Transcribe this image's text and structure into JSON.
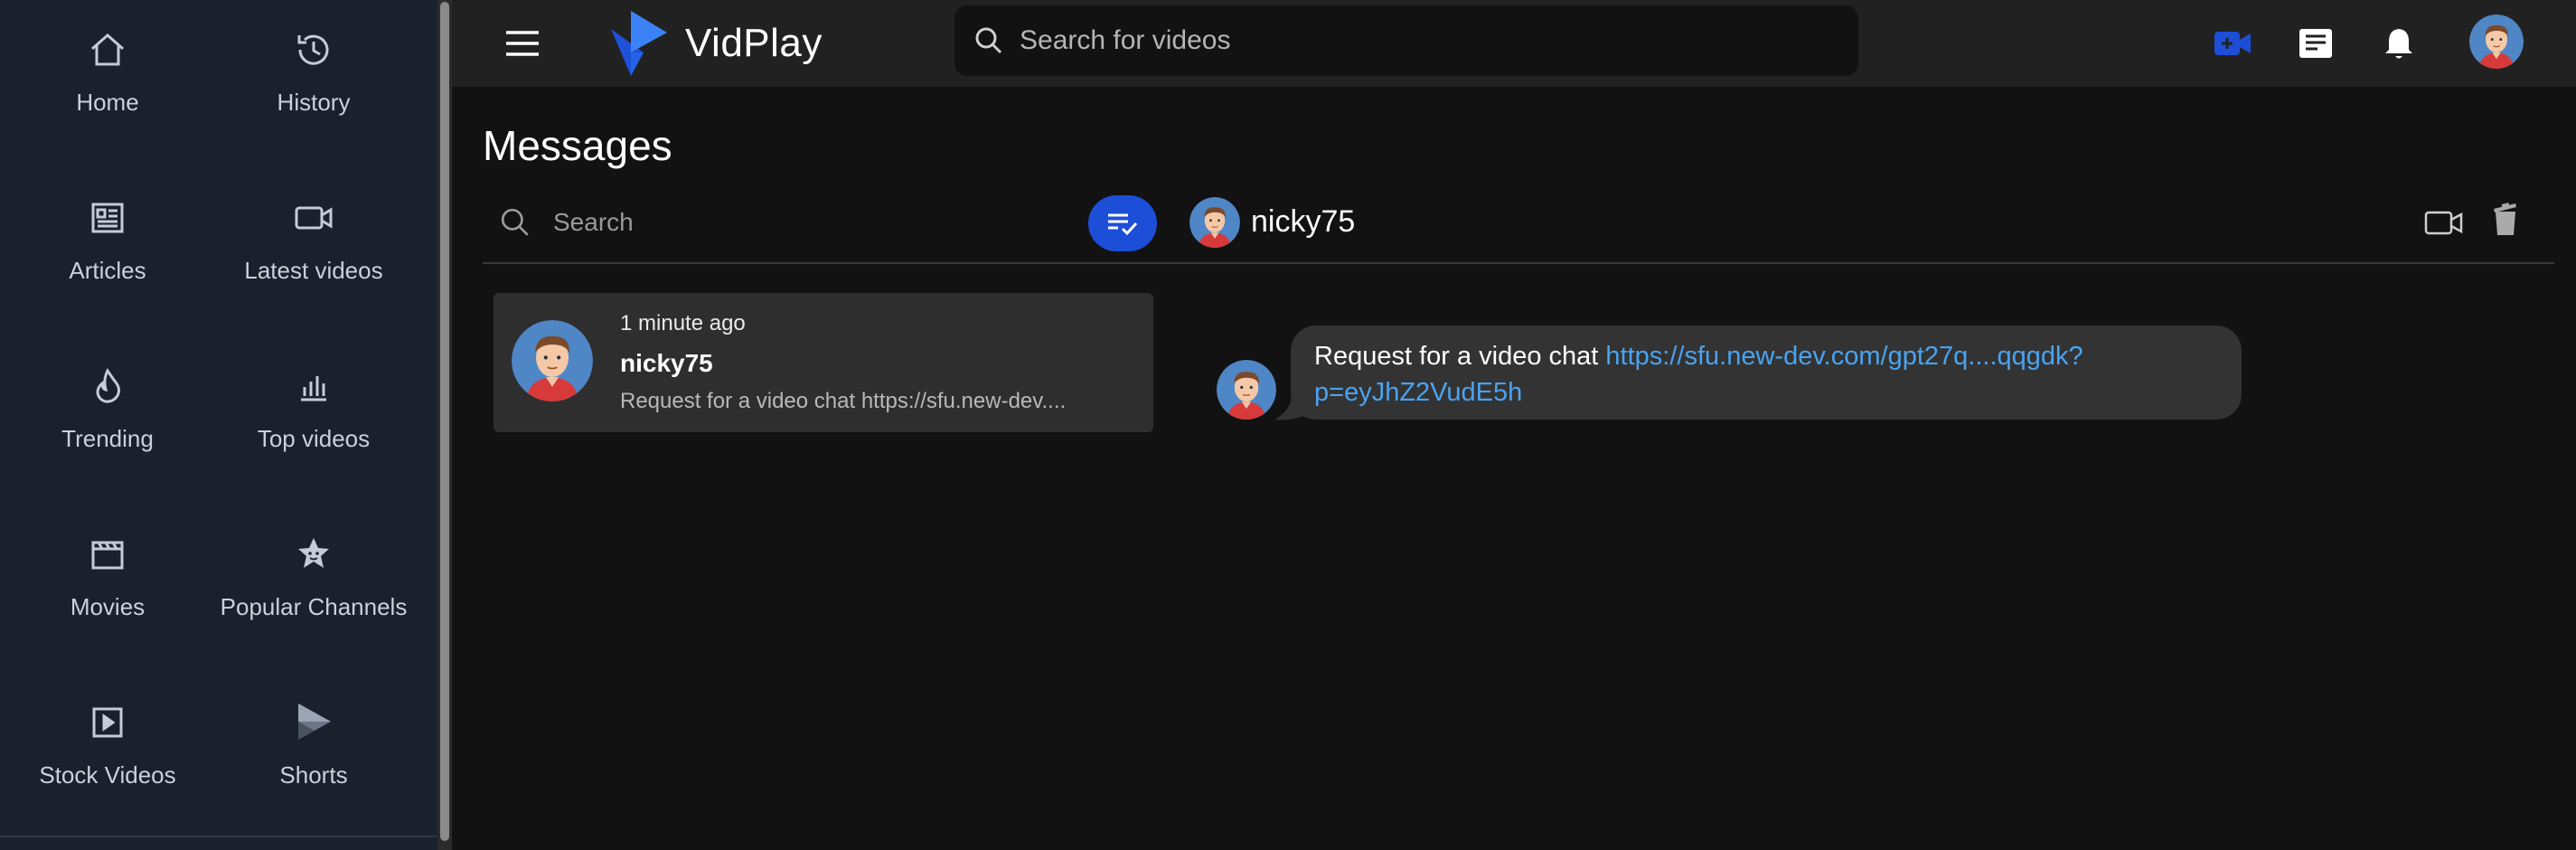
{
  "sidebar": {
    "items": [
      {
        "label": "Home",
        "icon": "home-icon"
      },
      {
        "label": "History",
        "icon": "history-icon"
      },
      {
        "label": "Articles",
        "icon": "articles-icon"
      },
      {
        "label": "Latest videos",
        "icon": "video-camera-icon"
      },
      {
        "label": "Trending",
        "icon": "flame-icon"
      },
      {
        "label": "Top videos",
        "icon": "bar-chart-icon"
      },
      {
        "label": "Movies",
        "icon": "clapperboard-icon"
      },
      {
        "label": "Popular Channels",
        "icon": "star-badge-icon"
      },
      {
        "label": "Stock Videos",
        "icon": "play-square-icon"
      },
      {
        "label": "Shorts",
        "icon": "shorts-play-icon"
      }
    ]
  },
  "header": {
    "brand": "VidPlay",
    "search_placeholder": "Search for videos",
    "accent_color": "#1d4ed8"
  },
  "messages": {
    "title": "Messages",
    "search_placeholder": "Search",
    "conversations": [
      {
        "time": "1 minute ago",
        "name": "nicky75",
        "preview": "Request for a video chat https://sfu.new-dev...."
      }
    ]
  },
  "chat": {
    "contact_name": "nicky75",
    "message_text": "Request for a video chat ",
    "message_link_line1": "https://sfu.new-dev.com/gpt27q....qqgdk?",
    "message_link_line2": "p=eyJhZ2VudE5h"
  }
}
